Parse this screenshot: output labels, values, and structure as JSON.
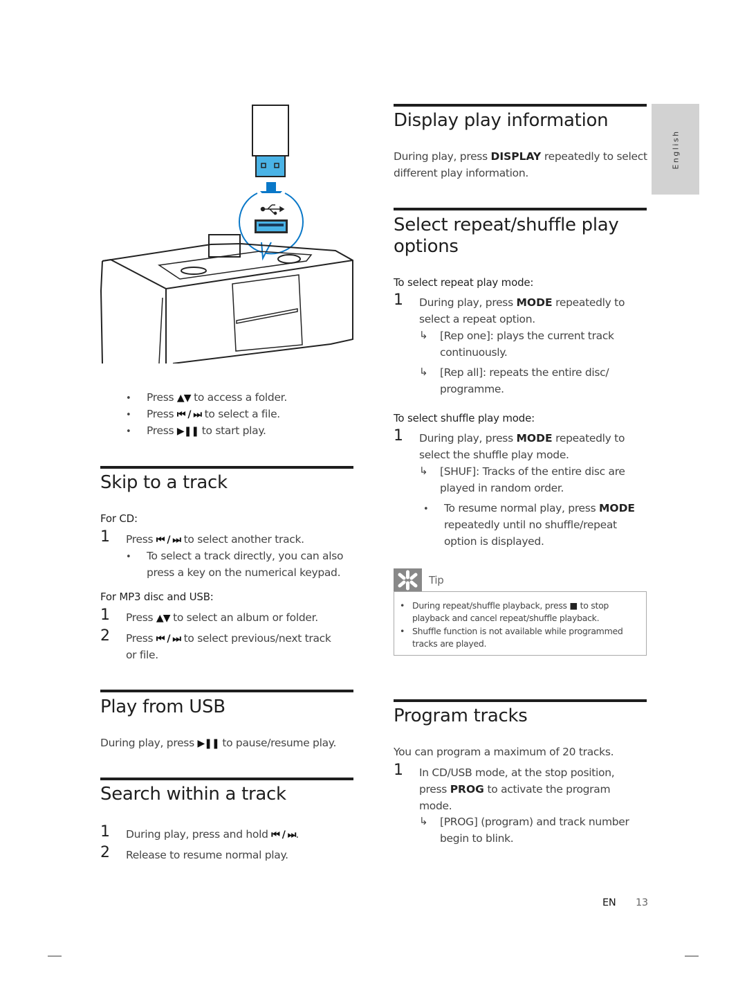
{
  "sidebar_tab": {
    "label": "English"
  },
  "left": {
    "illustration": {
      "alt": "USB flash drive being inserted into the USB port of a docking entertainment system",
      "accent_color": "#0a78c8",
      "usb_fill_color": "#4ab3e6"
    },
    "usb_bullets": [
      {
        "pre": "Press ",
        "glyph": "▲▼",
        "post": " to access a folder."
      },
      {
        "pre": "Press ",
        "glyph": "⏮ / ⏭",
        "post": " to select a file."
      },
      {
        "pre": "Press ",
        "glyph": "▶❚❚",
        "post": " to start play."
      }
    ],
    "skip": {
      "title": "Skip to a track",
      "for_cd": "For CD:",
      "cd_step1_num": "1",
      "cd_step1": {
        "pre": "Press ",
        "glyph": "⏮ / ⏭",
        "post": " to select another track."
      },
      "cd_step1_bullet_l1": "To select a track directly, you can also",
      "cd_step1_bullet_l2": "press a key on the numerical keypad.",
      "for_mp3": "For MP3 disc and USB:",
      "mp3_step1_num": "1",
      "mp3_step1": {
        "pre": "Press ",
        "glyph": "▲▼",
        "post": " to select an album or folder."
      },
      "mp3_step2_num": "2",
      "mp3_step2": {
        "pre": "Press ",
        "glyph": "⏮ / ⏭",
        "post": " to select previous/next track"
      },
      "mp3_step2_l2": "or file."
    },
    "play_usb": {
      "title": "Play from USB",
      "text": {
        "pre": "During play, press ",
        "glyph": "▶❚❚",
        "post": " to pause/resume play."
      }
    },
    "search": {
      "title": "Search within a track",
      "step1_num": "1",
      "step1": {
        "pre": "During play, press and hold ",
        "glyph": "⏮ / ⏭",
        "post": "."
      },
      "step2_num": "2",
      "step2": "Release to resume normal play."
    }
  },
  "right": {
    "display": {
      "title": "Display play information",
      "l1_pre": "During play, press ",
      "l1_key": "DISPLAY",
      "l1_post": " repeatedly to select",
      "l2": "different play information."
    },
    "repeat": {
      "title_l1": "Select repeat/shuffle play",
      "title_l2": "options",
      "repeat_sub": "To select repeat play mode:",
      "r_step_num": "1",
      "r_step_l1_pre": "During play, press ",
      "r_step_l1_key": "MODE",
      "r_step_l1_post": " repeatedly to",
      "r_step_l2": "select a repeat option.",
      "r_res1_l1": "[Rep one]: plays the current track",
      "r_res1_l2": "continuously.",
      "r_res2_l1": "[Rep all]: repeats the entire disc/",
      "r_res2_l2": "programme.",
      "shuffle_sub": "To select shuffle play mode:",
      "s_step_num": "1",
      "s_step_l1_pre": "During play, press ",
      "s_step_l1_key": "MODE",
      "s_step_l1_post": " repeatedly to",
      "s_step_l2": "select the shuffle play mode.",
      "s_res_l1": "[SHUF]: Tracks of the entire disc are",
      "s_res_l2": "played in random order.",
      "s_bullet_l1_pre": "To resume normal play, press ",
      "s_bullet_l1_key": "MODE",
      "s_bullet_l2": "repeatedly until no shuffle/repeat",
      "s_bullet_l3": "option is displayed.",
      "arrow_glyph": "↳"
    },
    "tip": {
      "label": "Tip",
      "items": [
        {
          "l1_pre": "During repeat/shuffle playback, press ",
          "glyph": "■",
          "l1_post": " to stop",
          "l2": "playback and cancel repeat/shuffle playback."
        },
        {
          "l1": "Shuffle function is not available while programmed",
          "l2": "tracks are played."
        }
      ]
    },
    "program": {
      "title": "Program tracks",
      "intro": "You can program a maximum of 20 tracks.",
      "step_num": "1",
      "step_l1": "In CD/USB mode, at the stop position,",
      "step_l2_pre": "press ",
      "step_l2_key": "PROG",
      "step_l2_post": " to activate the program",
      "step_l3": "mode.",
      "res_l1": "[PROG] (program) and track number",
      "res_l2": "begin to blink."
    }
  },
  "footer": {
    "lang": "EN",
    "page": "13"
  }
}
